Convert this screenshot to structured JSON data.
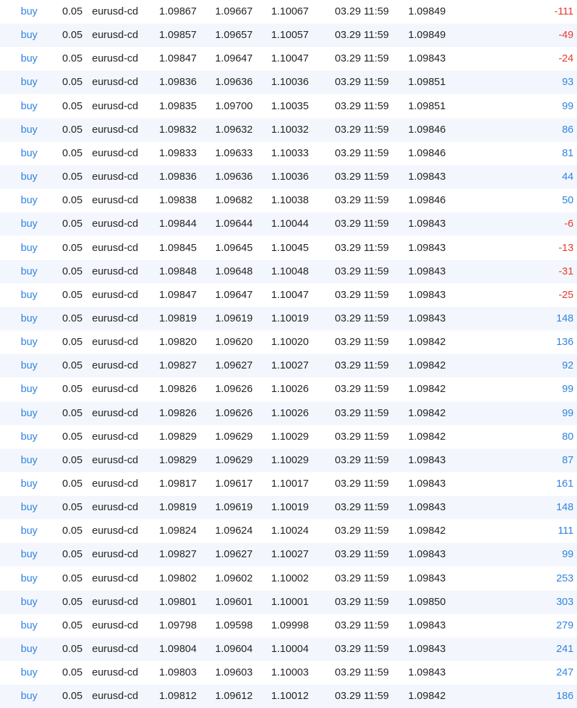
{
  "colors": {
    "link": "#2f83e0",
    "profit_positive": "#2f83e0",
    "profit_negative": "#e5392b",
    "row_alt_background": "#f3f7fd"
  },
  "trades": [
    {
      "type": "buy",
      "volume": "0.05",
      "symbol": "eurusd-cd",
      "open_price": "1.09867",
      "sl": "1.09667",
      "tp": "1.10067",
      "time": "03.29 11:59",
      "price": "1.09849",
      "profit": "-111"
    },
    {
      "type": "buy",
      "volume": "0.05",
      "symbol": "eurusd-cd",
      "open_price": "1.09857",
      "sl": "1.09657",
      "tp": "1.10057",
      "time": "03.29 11:59",
      "price": "1.09849",
      "profit": "-49"
    },
    {
      "type": "buy",
      "volume": "0.05",
      "symbol": "eurusd-cd",
      "open_price": "1.09847",
      "sl": "1.09647",
      "tp": "1.10047",
      "time": "03.29 11:59",
      "price": "1.09843",
      "profit": "-24"
    },
    {
      "type": "buy",
      "volume": "0.05",
      "symbol": "eurusd-cd",
      "open_price": "1.09836",
      "sl": "1.09636",
      "tp": "1.10036",
      "time": "03.29 11:59",
      "price": "1.09851",
      "profit": "93"
    },
    {
      "type": "buy",
      "volume": "0.05",
      "symbol": "eurusd-cd",
      "open_price": "1.09835",
      "sl": "1.09700",
      "tp": "1.10035",
      "time": "03.29 11:59",
      "price": "1.09851",
      "profit": "99"
    },
    {
      "type": "buy",
      "volume": "0.05",
      "symbol": "eurusd-cd",
      "open_price": "1.09832",
      "sl": "1.09632",
      "tp": "1.10032",
      "time": "03.29 11:59",
      "price": "1.09846",
      "profit": "86"
    },
    {
      "type": "buy",
      "volume": "0.05",
      "symbol": "eurusd-cd",
      "open_price": "1.09833",
      "sl": "1.09633",
      "tp": "1.10033",
      "time": "03.29 11:59",
      "price": "1.09846",
      "profit": "81"
    },
    {
      "type": "buy",
      "volume": "0.05",
      "symbol": "eurusd-cd",
      "open_price": "1.09836",
      "sl": "1.09636",
      "tp": "1.10036",
      "time": "03.29 11:59",
      "price": "1.09843",
      "profit": "44"
    },
    {
      "type": "buy",
      "volume": "0.05",
      "symbol": "eurusd-cd",
      "open_price": "1.09838",
      "sl": "1.09682",
      "tp": "1.10038",
      "time": "03.29 11:59",
      "price": "1.09846",
      "profit": "50"
    },
    {
      "type": "buy",
      "volume": "0.05",
      "symbol": "eurusd-cd",
      "open_price": "1.09844",
      "sl": "1.09644",
      "tp": "1.10044",
      "time": "03.29 11:59",
      "price": "1.09843",
      "profit": "-6"
    },
    {
      "type": "buy",
      "volume": "0.05",
      "symbol": "eurusd-cd",
      "open_price": "1.09845",
      "sl": "1.09645",
      "tp": "1.10045",
      "time": "03.29 11:59",
      "price": "1.09843",
      "profit": "-13"
    },
    {
      "type": "buy",
      "volume": "0.05",
      "symbol": "eurusd-cd",
      "open_price": "1.09848",
      "sl": "1.09648",
      "tp": "1.10048",
      "time": "03.29 11:59",
      "price": "1.09843",
      "profit": "-31"
    },
    {
      "type": "buy",
      "volume": "0.05",
      "symbol": "eurusd-cd",
      "open_price": "1.09847",
      "sl": "1.09647",
      "tp": "1.10047",
      "time": "03.29 11:59",
      "price": "1.09843",
      "profit": "-25"
    },
    {
      "type": "buy",
      "volume": "0.05",
      "symbol": "eurusd-cd",
      "open_price": "1.09819",
      "sl": "1.09619",
      "tp": "1.10019",
      "time": "03.29 11:59",
      "price": "1.09843",
      "profit": "148"
    },
    {
      "type": "buy",
      "volume": "0.05",
      "symbol": "eurusd-cd",
      "open_price": "1.09820",
      "sl": "1.09620",
      "tp": "1.10020",
      "time": "03.29 11:59",
      "price": "1.09842",
      "profit": "136"
    },
    {
      "type": "buy",
      "volume": "0.05",
      "symbol": "eurusd-cd",
      "open_price": "1.09827",
      "sl": "1.09627",
      "tp": "1.10027",
      "time": "03.29 11:59",
      "price": "1.09842",
      "profit": "92"
    },
    {
      "type": "buy",
      "volume": "0.05",
      "symbol": "eurusd-cd",
      "open_price": "1.09826",
      "sl": "1.09626",
      "tp": "1.10026",
      "time": "03.29 11:59",
      "price": "1.09842",
      "profit": "99"
    },
    {
      "type": "buy",
      "volume": "0.05",
      "symbol": "eurusd-cd",
      "open_price": "1.09826",
      "sl": "1.09626",
      "tp": "1.10026",
      "time": "03.29 11:59",
      "price": "1.09842",
      "profit": "99"
    },
    {
      "type": "buy",
      "volume": "0.05",
      "symbol": "eurusd-cd",
      "open_price": "1.09829",
      "sl": "1.09629",
      "tp": "1.10029",
      "time": "03.29 11:59",
      "price": "1.09842",
      "profit": "80"
    },
    {
      "type": "buy",
      "volume": "0.05",
      "symbol": "eurusd-cd",
      "open_price": "1.09829",
      "sl": "1.09629",
      "tp": "1.10029",
      "time": "03.29 11:59",
      "price": "1.09843",
      "profit": "87"
    },
    {
      "type": "buy",
      "volume": "0.05",
      "symbol": "eurusd-cd",
      "open_price": "1.09817",
      "sl": "1.09617",
      "tp": "1.10017",
      "time": "03.29 11:59",
      "price": "1.09843",
      "profit": "161"
    },
    {
      "type": "buy",
      "volume": "0.05",
      "symbol": "eurusd-cd",
      "open_price": "1.09819",
      "sl": "1.09619",
      "tp": "1.10019",
      "time": "03.29 11:59",
      "price": "1.09843",
      "profit": "148"
    },
    {
      "type": "buy",
      "volume": "0.05",
      "symbol": "eurusd-cd",
      "open_price": "1.09824",
      "sl": "1.09624",
      "tp": "1.10024",
      "time": "03.29 11:59",
      "price": "1.09842",
      "profit": "111"
    },
    {
      "type": "buy",
      "volume": "0.05",
      "symbol": "eurusd-cd",
      "open_price": "1.09827",
      "sl": "1.09627",
      "tp": "1.10027",
      "time": "03.29 11:59",
      "price": "1.09843",
      "profit": "99"
    },
    {
      "type": "buy",
      "volume": "0.05",
      "symbol": "eurusd-cd",
      "open_price": "1.09802",
      "sl": "1.09602",
      "tp": "1.10002",
      "time": "03.29 11:59",
      "price": "1.09843",
      "profit": "253"
    },
    {
      "type": "buy",
      "volume": "0.05",
      "symbol": "eurusd-cd",
      "open_price": "1.09801",
      "sl": "1.09601",
      "tp": "1.10001",
      "time": "03.29 11:59",
      "price": "1.09850",
      "profit": "303"
    },
    {
      "type": "buy",
      "volume": "0.05",
      "symbol": "eurusd-cd",
      "open_price": "1.09798",
      "sl": "1.09598",
      "tp": "1.09998",
      "time": "03.29 11:59",
      "price": "1.09843",
      "profit": "279"
    },
    {
      "type": "buy",
      "volume": "0.05",
      "symbol": "eurusd-cd",
      "open_price": "1.09804",
      "sl": "1.09604",
      "tp": "1.10004",
      "time": "03.29 11:59",
      "price": "1.09843",
      "profit": "241"
    },
    {
      "type": "buy",
      "volume": "0.05",
      "symbol": "eurusd-cd",
      "open_price": "1.09803",
      "sl": "1.09603",
      "tp": "1.10003",
      "time": "03.29 11:59",
      "price": "1.09843",
      "profit": "247"
    },
    {
      "type": "buy",
      "volume": "0.05",
      "symbol": "eurusd-cd",
      "open_price": "1.09812",
      "sl": "1.09612",
      "tp": "1.10012",
      "time": "03.29 11:59",
      "price": "1.09842",
      "profit": "186"
    }
  ]
}
